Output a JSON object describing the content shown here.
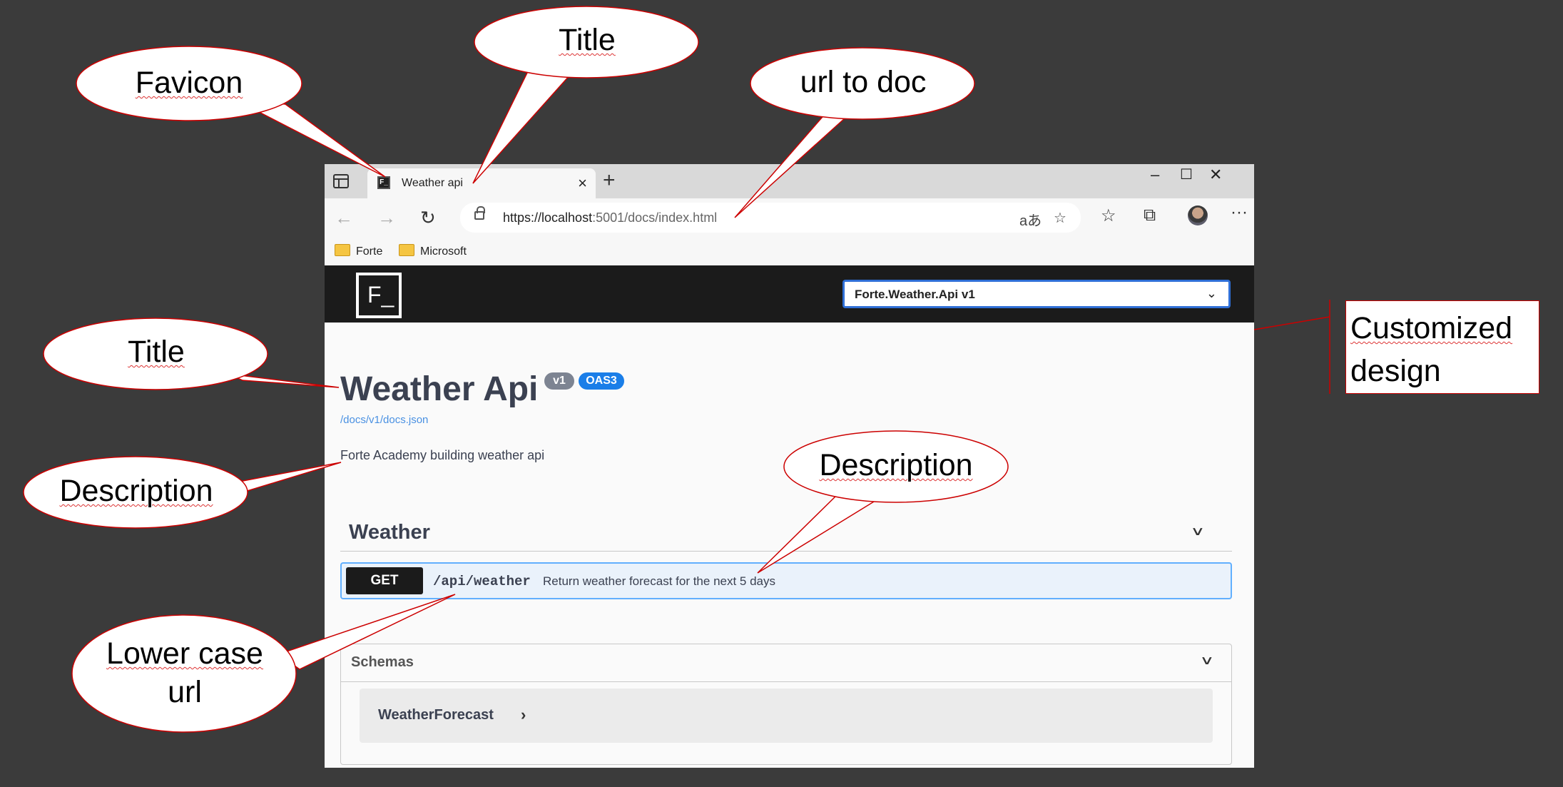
{
  "browser": {
    "tab_title": "Weather api",
    "favicon_glyph": "F_",
    "url_host": "https://localhost",
    "url_rest": ":5001/docs/index.html",
    "bookmarks": [
      "Forte",
      "Microsoft"
    ],
    "icons": {
      "back": "back-arrow-icon",
      "forward": "forward-arrow-icon",
      "refresh": "refresh-icon",
      "translate": "translate-icon",
      "add_favorite": "star-plus-icon",
      "favorites": "favorites-list-icon",
      "collections": "collections-icon",
      "more": "more-icon"
    }
  },
  "swagger": {
    "logo_glyph": "F_",
    "spec_selected": "Forte.Weather.Api v1",
    "title": "Weather Api",
    "version_badge": "v1",
    "oas_badge": "OAS3",
    "docs_link": "/docs/v1/docs.json",
    "description": "Forte Academy building weather api",
    "tag": "Weather",
    "operation": {
      "method": "GET",
      "path": "/api/weather",
      "summary": "Return weather forecast for the next 5 days"
    },
    "schemas_title": "Schemas",
    "schemas": [
      "WeatherForecast"
    ]
  },
  "callouts": {
    "favicon": "Favicon",
    "title_tab": "Title",
    "url_doc": "url to doc",
    "title_page": "Title",
    "description_left": "Description",
    "description_right": "Description",
    "lower_case_1": "Lower case",
    "lower_case_2": "url",
    "customized_1": "Customized",
    "customized_2": "design"
  },
  "colors": {
    "background": "#3b3b3b",
    "callout_border": "#cc0000",
    "get_method": "#1b1b1b",
    "operation_border": "#61affe",
    "version_badge": "#7d8492",
    "oas_badge": "#1a7ee8"
  }
}
